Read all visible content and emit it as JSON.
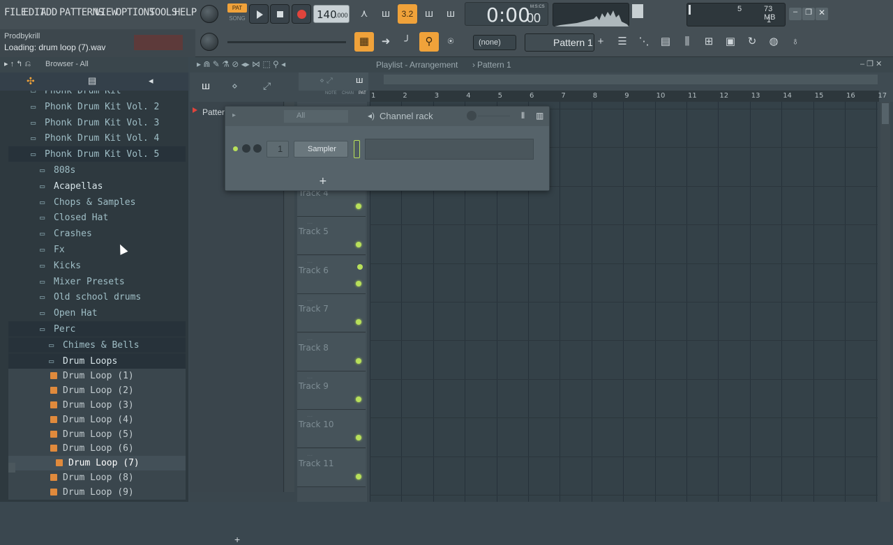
{
  "menu": [
    "FILE",
    "EDIT",
    "ADD",
    "PATTERNS",
    "VIEW",
    "OPTIONS",
    "TOOLS",
    "HELP"
  ],
  "transport": {
    "pat_label": "PAT",
    "song_label": "SONG",
    "tempo": "140",
    "tempo_decimals": ".000",
    "time": "0:00",
    "time_sub": "00",
    "time_unit": "M:S:CS",
    "step_label": "3.2"
  },
  "monitor": {
    "cpu": "5",
    "memory": "73 MB",
    "polyphony": "1"
  },
  "hint": {
    "title": "Prodbykrill",
    "status": "Loading: drum loop (7).wav"
  },
  "snap": "(none)",
  "pattern": "Pattern 1",
  "browser": {
    "header": "Browser - All",
    "folders": [
      "Phonk Drum Kit",
      "Phonk Drum Kit Vol. 2",
      "Phonk Drum Kit Vol. 3",
      "Phonk Drum Kit Vol. 4",
      "Phonk Drum Kit Vol. 5"
    ],
    "subfolders": [
      "808s",
      "Acapellas",
      "Chops & Samples",
      "Closed Hat",
      "Crashes",
      "Fx",
      "Kicks",
      "Mixer Presets",
      "Old school drums",
      "Open Hat",
      "Perc"
    ],
    "perc_children": [
      "Chimes & Bells",
      "Drum Loops"
    ],
    "files": [
      "Drum Loop (1)",
      "Drum Loop (2)",
      "Drum Loop (3)",
      "Drum Loop (4)",
      "Drum Loop (5)",
      "Drum Loop (6)",
      "Drum Loop (7)",
      "Drum Loop (8)",
      "Drum Loop (9)"
    ]
  },
  "playlist": {
    "title": "Playlist - Arrangement",
    "pattern": "Pattern 1",
    "pattern_list_item": "Patter",
    "mode_labels": [
      "NOTE",
      "CHAN",
      "PAT"
    ],
    "ruler": [
      "1",
      "2",
      "3",
      "4",
      "5",
      "6",
      "7",
      "8",
      "9",
      "10",
      "11",
      "12",
      "13",
      "14",
      "15",
      "16",
      "17"
    ],
    "tracks": [
      "Track 4",
      "Track 5",
      "Track 6",
      "Track 7",
      "Track 8",
      "Track 9",
      "Track 10",
      "Track 11"
    ],
    "add_symbol": "+"
  },
  "channel_rack": {
    "filter": "All",
    "title": "Channel rack",
    "channel_number": "1",
    "channel_name": "Sampler",
    "add_symbol": "+"
  },
  "colors": {
    "accent_orange": "#f0a23a",
    "led_green": "#b8e05a",
    "file_icon": "#e08a3c",
    "record_red": "#e0443c"
  }
}
